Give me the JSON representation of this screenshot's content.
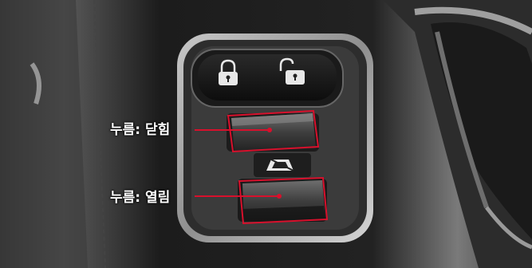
{
  "callouts": {
    "close_label": "누름: 닫힘",
    "open_label": "누름: 열림"
  },
  "icons": {
    "lock": "padlock-closed-icon",
    "unlock": "padlock-open-icon",
    "window_lock": "window-lock-icon"
  },
  "colors": {
    "callout_line": "#d8102c",
    "callout_text": "#ffffff"
  }
}
